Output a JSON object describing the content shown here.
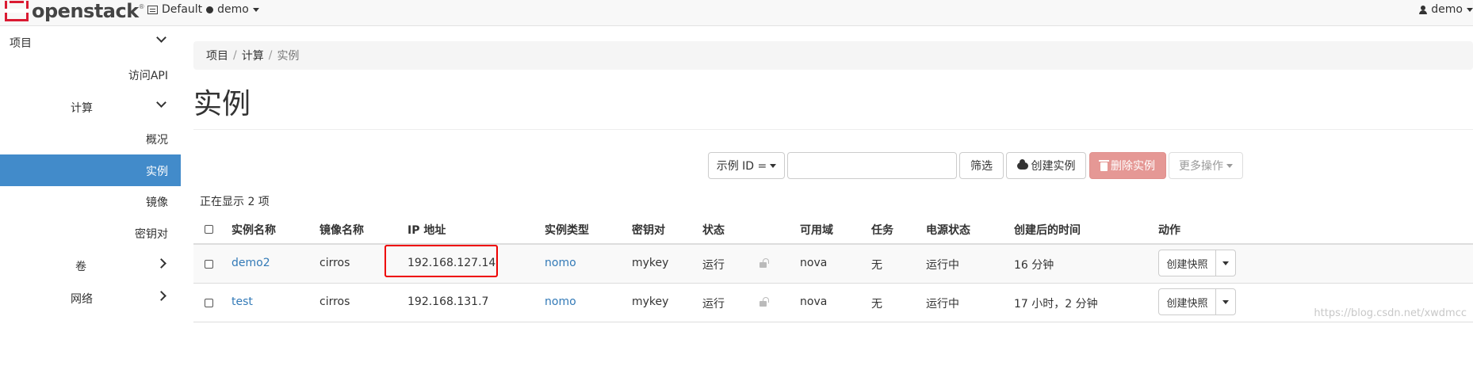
{
  "header": {
    "logo_text": "openstack",
    "logo_reg": "®",
    "project_domain": "Default",
    "project_name": "demo",
    "user_name": "demo"
  },
  "sidebar": {
    "project": "项目",
    "access_api": "访问API",
    "compute": "计算",
    "overview": "概况",
    "instances": "实例",
    "images": "镜像",
    "key_pairs": "密钥对",
    "volumes": "卷",
    "network": "网络"
  },
  "breadcrumb": [
    "项目",
    "计算",
    "实例"
  ],
  "breadcrumb_sep": "/",
  "page_title": "实例",
  "toolbar": {
    "filter_select": "示例 ID =",
    "search_value": "",
    "filter_button": "筛选",
    "create_button": "创建实例",
    "delete_button": "删除实例",
    "more_button": "更多操作"
  },
  "count_text": "正在显示 2 项",
  "table": {
    "headers": {
      "name": "实例名称",
      "image": "镜像名称",
      "ip": "IP 地址",
      "flavor": "实例类型",
      "keypair": "密钥对",
      "status": "状态",
      "az": "可用域",
      "task": "任务",
      "power": "电源状态",
      "age": "创建后的时间",
      "actions": "动作"
    },
    "rows": [
      {
        "name": "demo2",
        "image": "cirros",
        "ip": "192.168.127.14",
        "flavor": "nomo",
        "keypair": "mykey",
        "status": "运行",
        "az": "nova",
        "task": "无",
        "power": "运行中",
        "age": "16 分钟",
        "action": "创建快照"
      },
      {
        "name": "test",
        "image": "cirros",
        "ip": "192.168.131.7",
        "flavor": "nomo",
        "keypair": "mykey",
        "status": "运行",
        "az": "nova",
        "task": "无",
        "power": "运行中",
        "age": "17 小时，2 分钟",
        "action": "创建快照"
      }
    ]
  },
  "watermark": "https://blog.csdn.net/xwdmcc",
  "colors": {
    "accent": "#428bca",
    "link": "#337ab7",
    "danger": "#e59895",
    "highlight": "#ee0000",
    "logo_red": "#da1a32"
  },
  "icons": [
    "project-icon",
    "user-icon",
    "chevron-down-icon",
    "chevron-right-icon",
    "cloud-upload-icon",
    "trash-icon",
    "lock-icon",
    "caret-down-icon"
  ]
}
